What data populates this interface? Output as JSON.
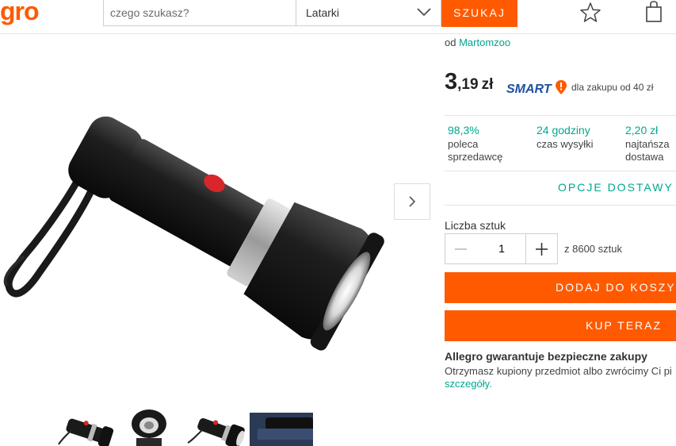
{
  "header": {
    "logo_text": "gro",
    "search_placeholder": "czego szukasz?",
    "category": "Latarki",
    "search_button": "SZUKAJ",
    "icons": [
      "star-icon",
      "cart-icon",
      "chevron-down-icon"
    ]
  },
  "offer": {
    "seller_prefix": "od",
    "seller_name": "Martomzoo",
    "price_int": "3",
    "price_dec": ",19",
    "currency": "zł",
    "smart_label": "SMART",
    "smart_note": "dla zakupu od 40 zł",
    "stats": [
      {
        "value": "98,3%",
        "label1": "poleca",
        "label2": "sprzedawcę"
      },
      {
        "value": "24 godziny",
        "label1": "czas wysyłki",
        "label2": ""
      },
      {
        "value": "2,20 zł",
        "label1": "najtańsza",
        "label2": "dostawa"
      }
    ],
    "delivery_options": "OPCJE DOSTAWY",
    "quantity_label": "Liczba sztuk",
    "quantity_value": "1",
    "quantity_available": "z 8600 sztuk",
    "add_to_cart": "DODAJ DO KOSZYKA",
    "buy_now": "KUP TERAZ",
    "guarantee_title": "Allegro gwarantuje bezpieczne zakupy",
    "guarantee_text": "Otrzymasz kupiony przedmiot albo zwrócimy Ci pi",
    "guarantee_link": "szczegóły"
  },
  "colors": {
    "brand": "#ff5a00",
    "link": "#00a790",
    "smart": "#1f4fa1"
  }
}
